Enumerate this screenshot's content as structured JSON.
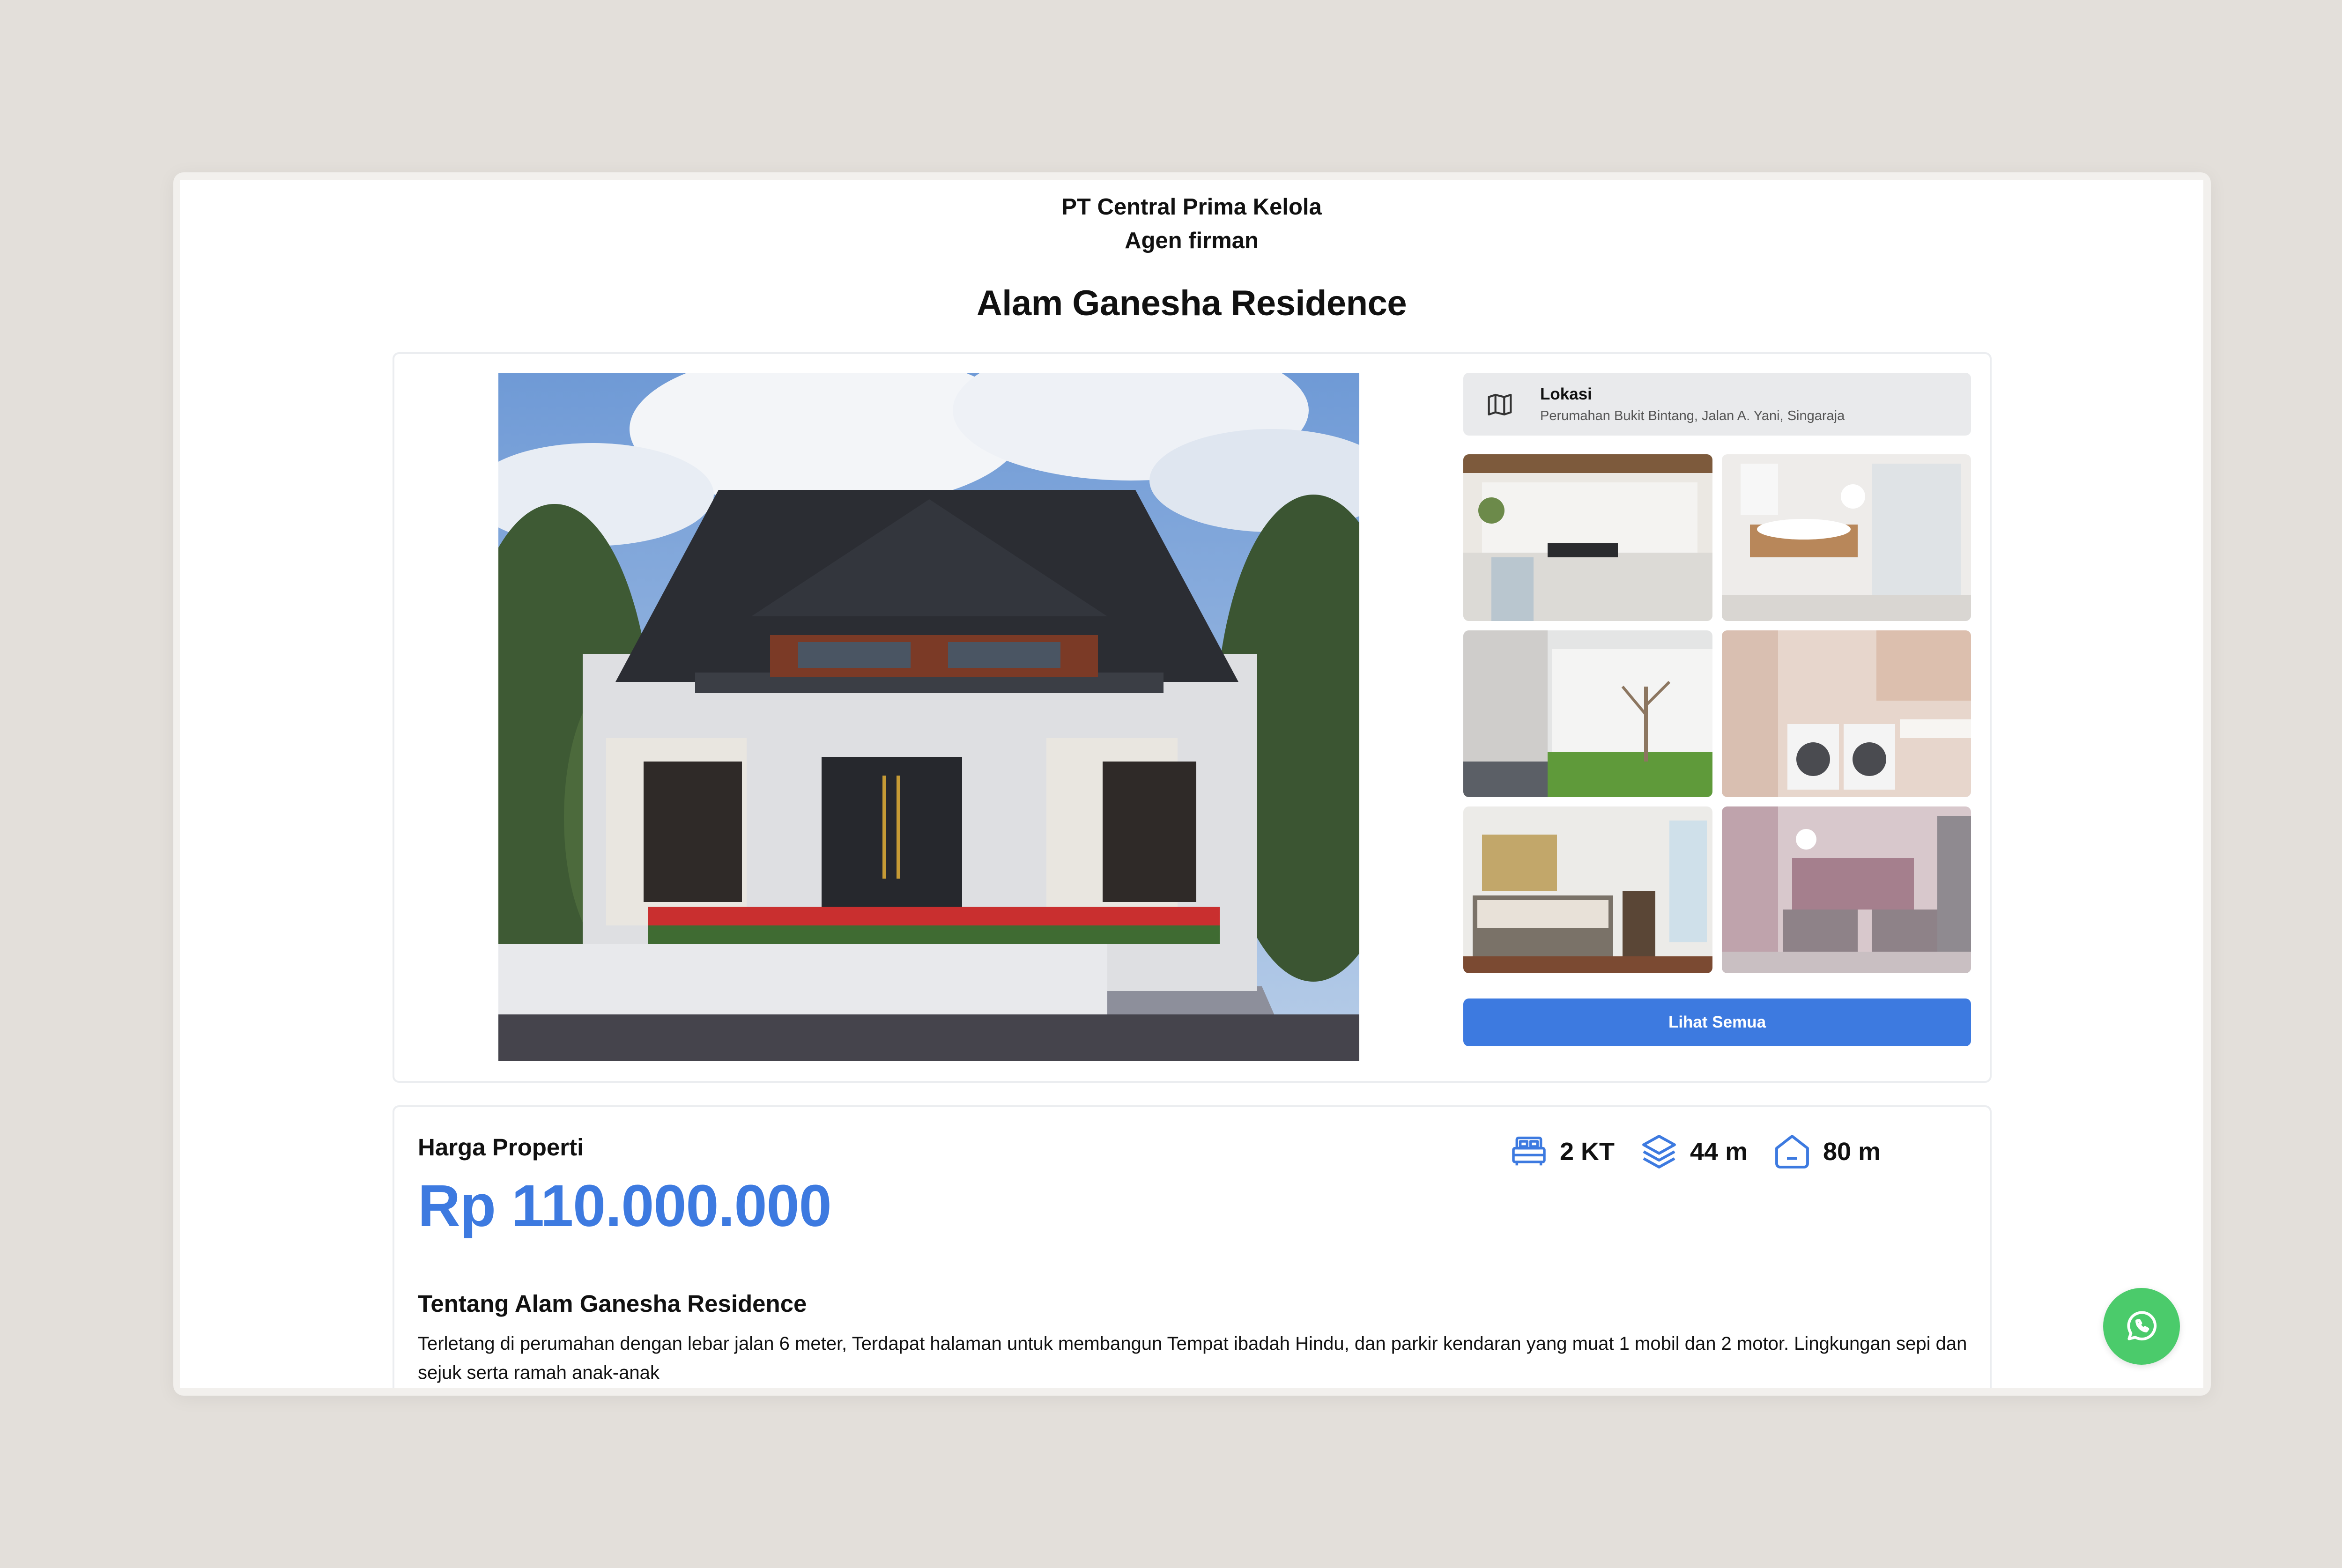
{
  "company": {
    "name": "PT Central Prima Kelola",
    "agent": "Agen firman"
  },
  "property": {
    "title": "Alam Ganesha Residence"
  },
  "location": {
    "label": "Lokasi",
    "address": "Perumahan Bukit Bintang, Jalan A. Yani, Singaraja",
    "icon": "map-icon"
  },
  "gallery": {
    "button_label": "Lihat Semua",
    "thumbnails": [
      "kitchen",
      "bathroom",
      "garden",
      "laundry",
      "bedroom",
      "kids-bedroom"
    ]
  },
  "pricing": {
    "label": "Harga Properti",
    "value": "Rp 110.000.000"
  },
  "specs": [
    {
      "icon": "bed-icon",
      "value": "2 KT"
    },
    {
      "icon": "layers-icon",
      "value": "44 m"
    },
    {
      "icon": "house-icon",
      "value": "80 m"
    }
  ],
  "about": {
    "title": "Tentang Alam Ganesha Residence",
    "text": "Terletang di perumahan dengan lebar jalan 6 meter, Terdapat halaman untuk membangun Tempat ibadah Hindu, dan parkir kendaran yang muat 1 mobil dan 2 motor. Lingkungan sepi dan sejuk serta ramah anak-anak"
  },
  "colors": {
    "accent": "#3d7ae0",
    "whatsapp": "#4bcb6b",
    "background": "#e3dfda"
  },
  "fab": {
    "icon": "whatsapp-icon"
  }
}
